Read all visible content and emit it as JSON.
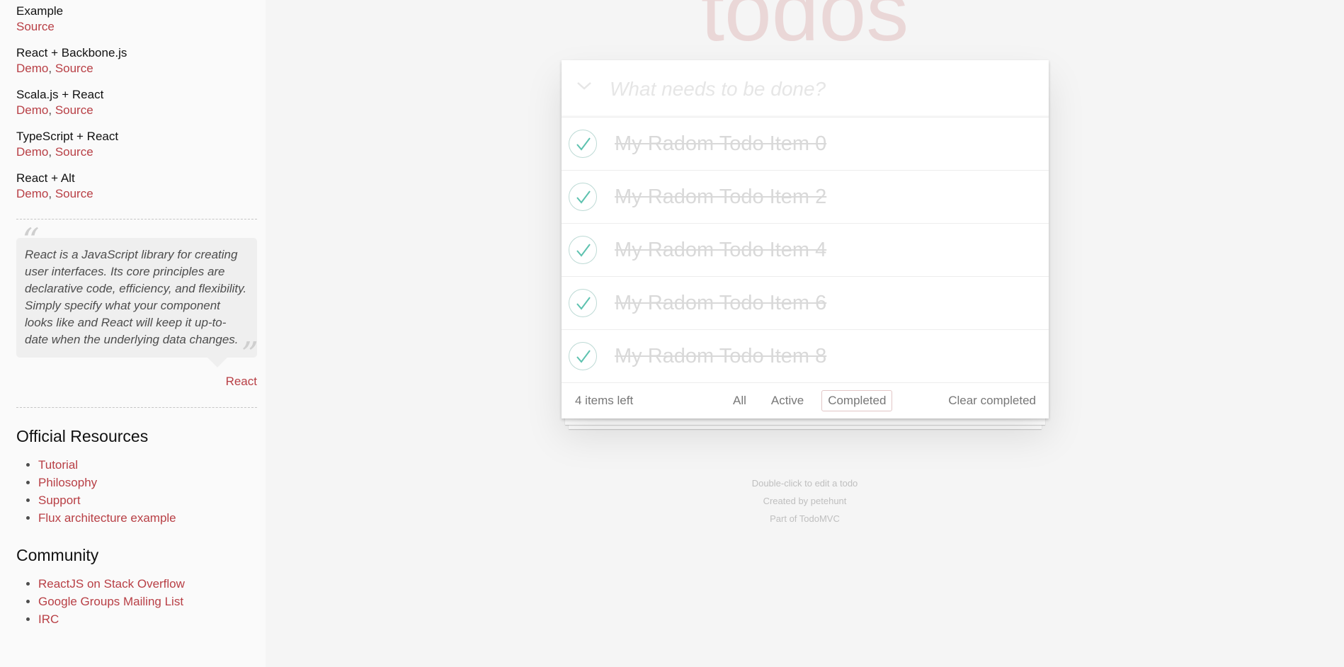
{
  "sidebar": {
    "examples": [
      {
        "name": "Example",
        "links": [
          "Source"
        ]
      },
      {
        "name": "React + Backbone.js",
        "links": [
          "Demo",
          "Source"
        ]
      },
      {
        "name": "Scala.js + React",
        "links": [
          "Demo",
          "Source"
        ]
      },
      {
        "name": "TypeScript + React",
        "links": [
          "Demo",
          "Source"
        ]
      },
      {
        "name": "React + Alt",
        "links": [
          "Demo",
          "Source"
        ]
      }
    ],
    "quote": {
      "text": "React is a JavaScript library for creating user interfaces. Its core principles are declarative code, efficiency, and flexibility. Simply specify what your component looks like and React will keep it up-to-date when the underlying data changes.",
      "source": "React"
    },
    "official_resources": {
      "title": "Official Resources",
      "items": [
        "Tutorial",
        "Philosophy",
        "Support",
        "Flux architecture example"
      ]
    },
    "community": {
      "title": "Community",
      "items": [
        "ReactJS on Stack Overflow",
        "Google Groups Mailing List",
        "IRC"
      ]
    }
  },
  "app": {
    "title": "todos",
    "input_placeholder": "What needs to be done?",
    "todos": [
      {
        "label": "My Radom Todo Item 0",
        "completed": true
      },
      {
        "label": "My Radom Todo Item 2",
        "completed": true
      },
      {
        "label": "My Radom Todo Item 4",
        "completed": true
      },
      {
        "label": "My Radom Todo Item 6",
        "completed": true
      },
      {
        "label": "My Radom Todo Item 8",
        "completed": true
      }
    ],
    "footer": {
      "count": "4 items left",
      "filters": [
        "All",
        "Active",
        "Completed"
      ],
      "selected_filter": "Completed",
      "clear": "Clear completed"
    }
  },
  "info": {
    "line1": "Double-click to edit a todo",
    "line2": "Created by petehunt",
    "line3": "Part of TodoMVC"
  },
  "colors": {
    "accent": "#b83f45",
    "check": "#5dc2af",
    "title": "#ead7d7"
  }
}
